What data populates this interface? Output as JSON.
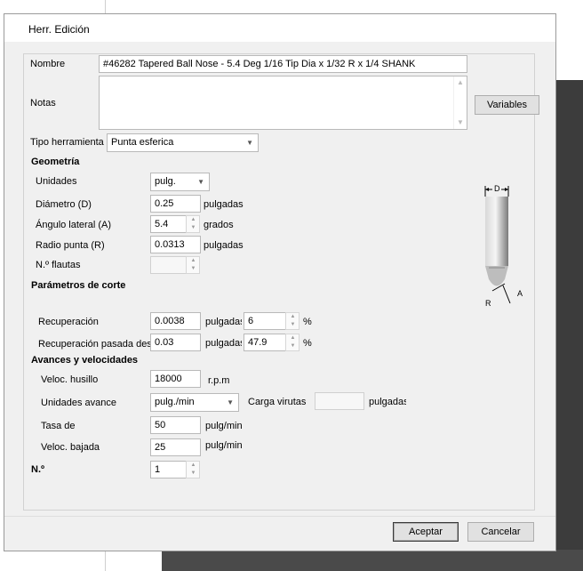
{
  "dialog": {
    "title": "Herr. Edición"
  },
  "fields": {
    "nombre_label": "Nombre",
    "nombre_value": "#46282 Tapered Ball Nose - 5.4 Deg 1/16 Tip Dia x 1/32 R x 1/4 SHANK",
    "notas_label": "Notas",
    "notas_value": "",
    "variables_button": "Variables",
    "tipo_label": "Tipo herramienta",
    "tipo_value": "Punta esferica"
  },
  "geometria": {
    "header": "Geometría",
    "unidades_label": "Unidades",
    "unidades_value": "pulg.",
    "diametro_label": "Diámetro (D)",
    "diametro_value": "0.25",
    "diametro_unit": "pulgadas",
    "angulo_label": "Ángulo lateral (A)",
    "angulo_value": "5.4",
    "angulo_unit": "grados",
    "radio_label": "Radio punta (R)",
    "radio_value": "0.0313",
    "radio_unit": "pulgadas",
    "flautas_label": "N.º flautas",
    "flautas_value": ""
  },
  "diagram": {
    "label_d": "D",
    "label_a": "A",
    "label_r": "R"
  },
  "corte": {
    "header": "Parámetros de corte",
    "recuperacion_label": "Recuperación",
    "recuperacion_value": "0.0038",
    "recuperacion_unit": "pulgadas",
    "recuperacion_pct": "6",
    "pct_symbol": "%",
    "recuperacion_pasada_label": "Recuperación pasada desbaste",
    "recuperacion_pasada_value": "0.03",
    "recuperacion_pasada_unit": "pulgadas",
    "recuperacion_pasada_pct": "47.9"
  },
  "avances": {
    "header": "Avances y velocidades",
    "husillo_label": "Veloc. husillo",
    "husillo_value": "18000",
    "husillo_unit": "r.p.m",
    "unidades_avance_label": "Unidades avance",
    "unidades_avance_value": "pulg./min",
    "carga_label": "Carga virutas",
    "carga_value": "",
    "carga_unit": "pulgadas",
    "tasa_label": "Tasa de",
    "tasa_value": "50",
    "tasa_unit": "pulg/min",
    "bajada_label": "Veloc. bajada",
    "bajada_value": "25",
    "bajada_unit": "pulg/min"
  },
  "numero": {
    "label": "N.º",
    "value": "1"
  },
  "footer": {
    "ok_button": "Aceptar",
    "cancel_button": "Cancelar"
  }
}
